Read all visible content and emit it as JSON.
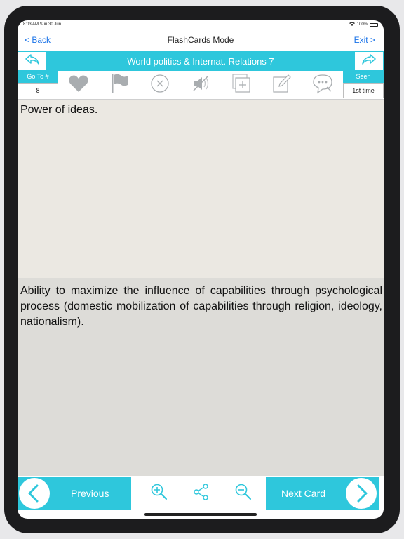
{
  "status": {
    "time": "8:03 AM  Sun 30 Jun",
    "battery": "100%"
  },
  "nav": {
    "back": "< Back",
    "title": "FlashCards Mode",
    "exit": "Exit >"
  },
  "deck": {
    "title": "World politics & Internat. Relations 7"
  },
  "goto": {
    "label": "Go To #",
    "value": "8"
  },
  "seen": {
    "label": "Seen",
    "value": "1st time"
  },
  "toolbar_icons": [
    "heart-icon",
    "flag-icon",
    "close-circle-icon",
    "mute-icon",
    "add-copy-icon",
    "edit-icon",
    "comment-icon"
  ],
  "card": {
    "question": "Power of ideas.",
    "answer": "Ability to maximize the influence of capabilities through psychological process (domestic mobilization of capabilities through religion, ideology, nationalism)."
  },
  "bottom": {
    "previous": "Previous",
    "next": "Next Card"
  },
  "colors": {
    "accent": "#2ec7dc",
    "link": "#1a73e8",
    "question_bg": "#ebe8e2",
    "answer_bg": "#dddcd8"
  }
}
